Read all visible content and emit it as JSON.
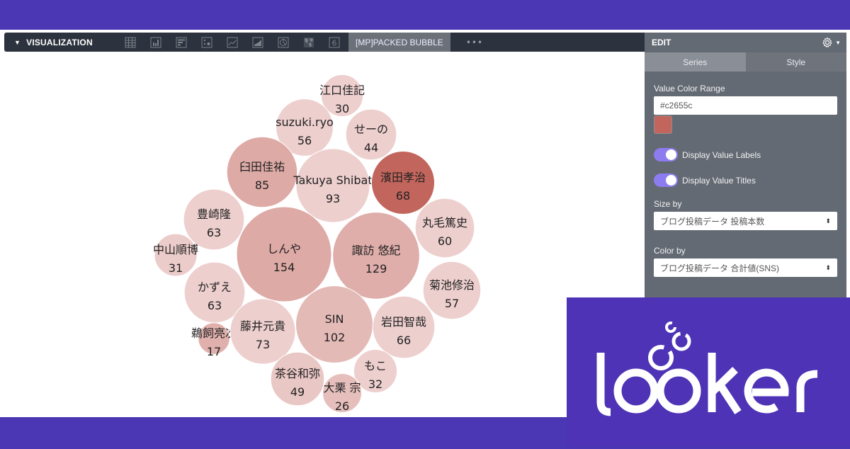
{
  "toolbar": {
    "title": "VISUALIZATION",
    "icons": [
      "table-icon",
      "column-chart-icon",
      "bar-chart-icon",
      "scatter-icon",
      "line-chart-icon",
      "area-chart-icon",
      "pie-chart-icon",
      "map-icon",
      "single-value-icon"
    ],
    "single_value_glyph": "6",
    "active_tab": "[MP]PACKED BUBBLE",
    "more": "•••"
  },
  "panel": {
    "title": "EDIT",
    "tabs": [
      {
        "label": "Series",
        "active": true
      },
      {
        "label": "Style",
        "active": false
      }
    ],
    "value_color_range_label": "Value Color Range",
    "value_color_range_value": "#c2655c",
    "swatch_color": "#c2655c",
    "toggles": [
      {
        "label": "Display Value Labels",
        "on": true
      },
      {
        "label": "Display Value Titles",
        "on": true
      }
    ],
    "size_by_label": "Size by",
    "size_by_value": "ブログ投稿データ 投稿本数",
    "color_by_label": "Color by",
    "color_by_value": "ブログ投稿データ 合計値(SNS)"
  },
  "logo": {
    "text": "looker"
  },
  "chart_data": {
    "type": "packed-bubble",
    "size_by": "ブログ投稿データ 投稿本数",
    "color_by": "ブログ投稿データ 合計値(SNS)",
    "color_range": "#c2655c",
    "bubbles": [
      {
        "name": "江口佳記",
        "value": 30,
        "shade": 0.15
      },
      {
        "name": "suzuki.ryo",
        "value": 56,
        "shade": 0.15
      },
      {
        "name": "せーの",
        "value": 44,
        "shade": 0.15
      },
      {
        "name": "臼田佳祐",
        "value": 85,
        "shade": 0.45
      },
      {
        "name": "Takuya Shibat",
        "value": 93,
        "shade": 0.15
      },
      {
        "name": "濱田孝治",
        "value": 68,
        "shade": 1.0
      },
      {
        "name": "豊崎隆",
        "value": 63,
        "shade": 0.15
      },
      {
        "name": "丸毛篤史",
        "value": 60,
        "shade": 0.15
      },
      {
        "name": "中山順博",
        "value": 31,
        "shade": 0.18
      },
      {
        "name": "しんや",
        "value": 154,
        "shade": 0.45
      },
      {
        "name": "諏訪 悠紀",
        "value": 129,
        "shade": 0.42
      },
      {
        "name": "菊池修治",
        "value": 57,
        "shade": 0.15
      },
      {
        "name": "かずえ",
        "value": 63,
        "shade": 0.15
      },
      {
        "name": "鵜飼亮次",
        "value": 17,
        "shade": 0.4
      },
      {
        "name": "藤井元貴",
        "value": 73,
        "shade": 0.15
      },
      {
        "name": "SIN",
        "value": 102,
        "shade": 0.32
      },
      {
        "name": "岩田智哉",
        "value": 66,
        "shade": 0.15
      },
      {
        "name": "もこ",
        "value": 32,
        "shade": 0.15
      },
      {
        "name": "茶谷和弥",
        "value": 49,
        "shade": 0.22
      },
      {
        "name": "大栗 宗",
        "value": 26,
        "shade": 0.28
      }
    ]
  }
}
